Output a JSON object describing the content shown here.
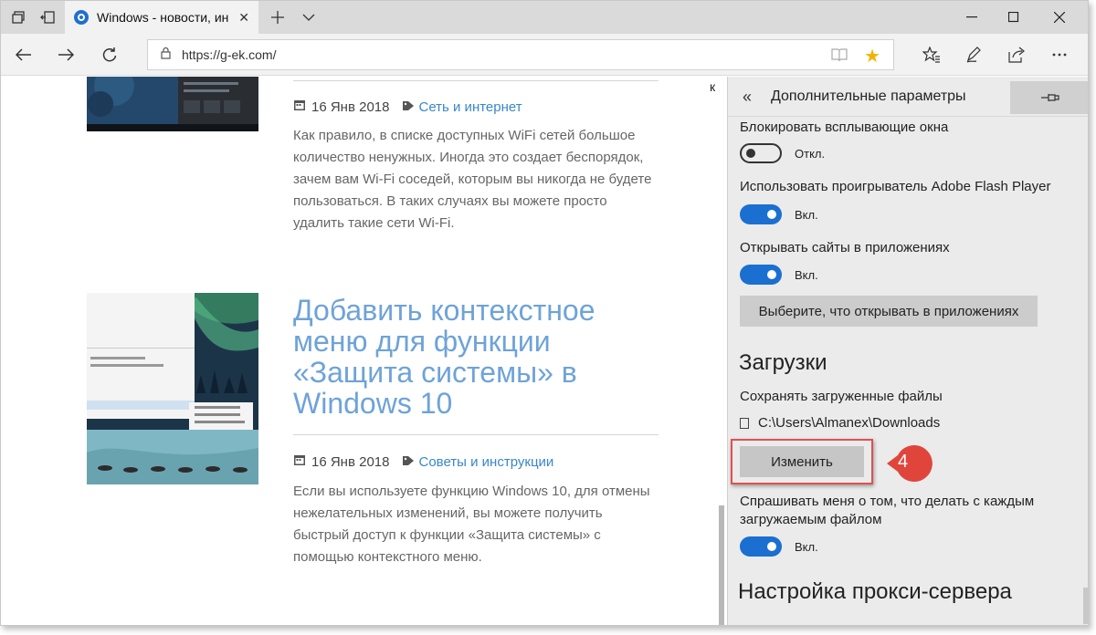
{
  "browser": {
    "tab_title": "Windows - новости, ин",
    "url": "https://g-ek.com/"
  },
  "articles": [
    {
      "date": "16 Янв 2018",
      "category": "Сеть и интернет",
      "excerpt_lines": [
        "Как правило, в списке доступных WiFi сетей большое",
        "количество ненужных. Иногда это создает беспорядок,",
        "зачем вам Wi-Fi соседей, которым вы никогда не будете",
        "пользоваться. В таких случаях вы можете просто",
        "удалить такие сети Wi-Fi."
      ]
    },
    {
      "title_lines": [
        "Добавить контекстное",
        "меню для функции",
        "«Защита системы» в",
        "Windows 10"
      ],
      "date": "16 Янв 2018",
      "category": "Советы и инструкции",
      "excerpt_lines": [
        "Если вы используете функцию Windows 10, для отмены",
        "нежелательных изменений, вы можете получить",
        "быстрый доступ к функции «Защита системы» с",
        "помощью контекстного меню."
      ]
    }
  ],
  "page_stray_letter": "к",
  "panel": {
    "title": "Дополнительные параметры",
    "popup_label": "Блокировать всплывающие окна",
    "popup_state": "Откл.",
    "flash_label": "Использовать проигрыватель Adobe Flash Player",
    "flash_state": "Вкл.",
    "apps_label": "Открывать сайты в приложениях",
    "apps_state": "Вкл.",
    "apps_button": "Выберите, что открывать в приложениях",
    "downloads_heading": "Загрузки",
    "save_label": "Сохранять загруженные файлы",
    "save_path": "C:\\Users\\Almanex\\Downloads",
    "change_button": "Изменить",
    "ask_label_line1": "Спрашивать меня о том, что делать с каждым",
    "ask_label_line2": "загружаемым файлом",
    "ask_state": "Вкл.",
    "proxy_heading": "Настройка прокси-сервера"
  },
  "annotation": {
    "step_number": "4",
    "color": "#e0453c"
  },
  "colors": {
    "accent": "#1a6fd1",
    "link": "#3a87c8",
    "headline": "#6ea3d8",
    "star": "#f0b400"
  }
}
